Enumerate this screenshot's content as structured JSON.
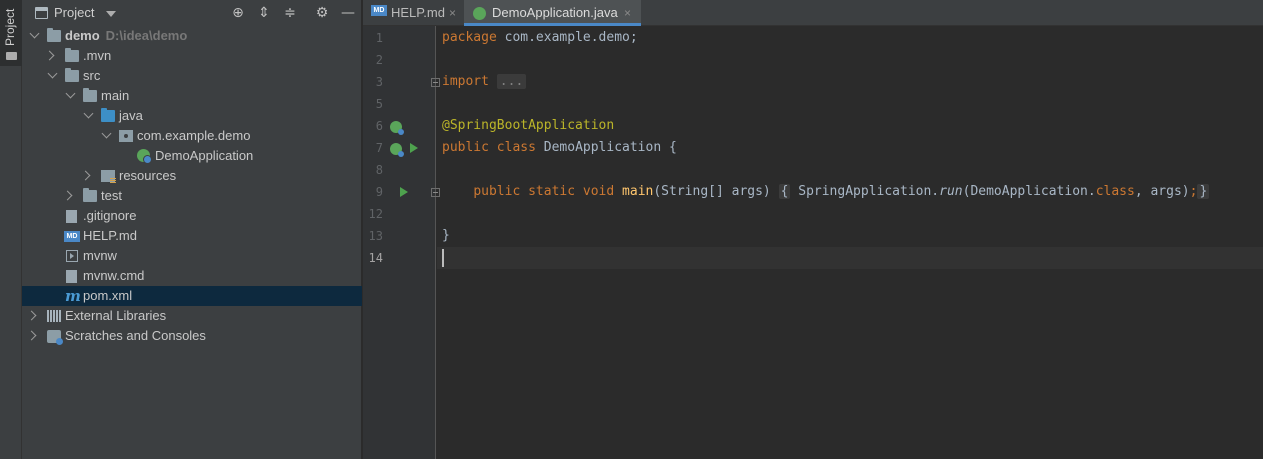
{
  "tool_strip": {
    "project_tab": "Project"
  },
  "project_panel": {
    "title": "Project",
    "header_buttons": [
      "locate-icon",
      "expand-all-icon",
      "collapse-all-icon",
      "gear-icon",
      "hide-icon"
    ],
    "tree": [
      {
        "label": "demo",
        "path": "D:\\idea\\demo",
        "icon": "folder-icon",
        "expanded": true
      },
      {
        "label": ".mvn",
        "icon": "folder-icon",
        "expanded": false
      },
      {
        "label": "src",
        "icon": "folder-icon",
        "expanded": true
      },
      {
        "label": "main",
        "icon": "folder-icon",
        "expanded": true
      },
      {
        "label": "java",
        "icon": "source-folder-icon",
        "expanded": true
      },
      {
        "label": "com.example.demo",
        "icon": "package-icon",
        "expanded": true
      },
      {
        "label": "DemoApplication",
        "icon": "spring-boot-class-icon"
      },
      {
        "label": "resources",
        "icon": "resources-folder-icon",
        "expanded": false
      },
      {
        "label": "test",
        "icon": "folder-icon",
        "expanded": false
      },
      {
        "label": ".gitignore",
        "icon": "gitignore-file-icon"
      },
      {
        "label": "HELP.md",
        "icon": "markdown-file-icon"
      },
      {
        "label": "mvnw",
        "icon": "executable-file-icon"
      },
      {
        "label": "mvnw.cmd",
        "icon": "text-file-icon"
      },
      {
        "label": "pom.xml",
        "icon": "maven-file-icon",
        "selected": true
      },
      {
        "label": "External Libraries",
        "icon": "libraries-icon",
        "expanded": false
      },
      {
        "label": "Scratches and Consoles",
        "icon": "scratches-icon",
        "expanded": false
      }
    ]
  },
  "editor": {
    "tabs": [
      {
        "label": "HELP.md",
        "icon": "markdown-file-icon",
        "close": "×",
        "active": false
      },
      {
        "label": "DemoApplication.java",
        "icon": "spring-boot-class-icon",
        "close": "×",
        "active": true
      }
    ],
    "line_numbers": [
      "1",
      "2",
      "3",
      "5",
      "6",
      "7",
      "8",
      "9",
      "12",
      "13",
      "14"
    ],
    "current_line": "14",
    "code": {
      "l1_kw": "package",
      "l1_rest": " com.example.demo;",
      "l3_kw": "import",
      "l3_fold": "...",
      "l6_ann": "@SpringBootApplication",
      "l7_kw1": "public",
      "l7_kw2": "class",
      "l7_rest": " DemoApplication {",
      "l9_kw1": "public",
      "l9_kw2": "static",
      "l9_kw3": "void",
      "l9_meth": "main",
      "l9_params": "(String[] args)",
      "l9_open": "{",
      "l9_body1": " SpringApplication.",
      "l9_run": "run",
      "l9_body2": "(DemoApplication.",
      "l9_class_kw": "class",
      "l9_body3": ", args)",
      "l9_semi": ";",
      "l9_close": "}",
      "l13": "}"
    },
    "colors": {
      "keyword": "#cc7832",
      "annotation": "#bbb529",
      "method": "#ffc66d",
      "text": "#a9b7c6",
      "selection": "#0d293e",
      "accent": "#4a88c7"
    }
  }
}
